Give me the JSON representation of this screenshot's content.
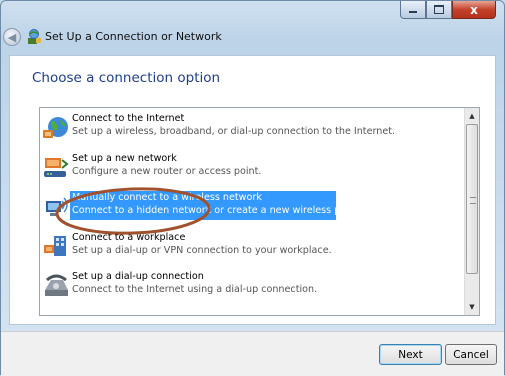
{
  "window": {
    "title": "Set Up a Connection or Network",
    "close_glyph": "x"
  },
  "heading": "Choose a connection option",
  "options": [
    {
      "title": "Connect to the Internet",
      "description": "Set up a wireless, broadband, or dial-up connection to the Internet.",
      "icon": "globe-network-icon"
    },
    {
      "title": "Set up a new network",
      "description": "Configure a new router or access point.",
      "icon": "router-icon"
    },
    {
      "title": "Manually connect to a wireless network",
      "description": "Connect to a hidden network or create a new wireless profile.",
      "icon": "wireless-network-icon",
      "selected": true
    },
    {
      "title": "Connect to a workplace",
      "description": "Set up a dial-up or VPN connection to your workplace.",
      "icon": "workplace-icon"
    },
    {
      "title": "Set up a dial-up connection",
      "description": "Connect to the Internet using a dial-up connection.",
      "icon": "dialup-phone-icon"
    }
  ],
  "buttons": {
    "next": "Next",
    "cancel": "Cancel"
  },
  "colors": {
    "selection": "#3399ff",
    "heading": "#1e3f8d",
    "annotation": "#a0522d"
  }
}
